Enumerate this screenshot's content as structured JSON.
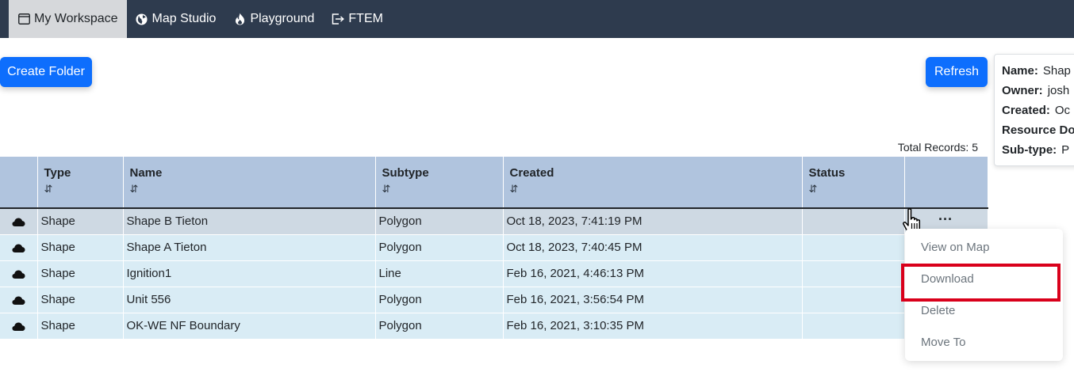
{
  "nav": {
    "items": [
      {
        "label": "My Workspace",
        "icon": "window-icon",
        "active": true
      },
      {
        "label": "Map Studio",
        "icon": "globe-icon"
      },
      {
        "label": "Playground",
        "icon": "fire-icon"
      },
      {
        "label": "FTEM",
        "icon": "box-arrow-right-icon"
      }
    ]
  },
  "toolbar": {
    "create_folder": "Create Folder",
    "refresh": "Refresh"
  },
  "total_records": "Total Records: 5",
  "info_panel": {
    "name_label": "Name:",
    "name_value": "Shap",
    "owner_label": "Owner:",
    "owner_value": "josh",
    "created_label": "Created:",
    "created_value": "Oc",
    "resource_label": "Resource Do",
    "subtype_label": "Sub-type:",
    "subtype_value": "P"
  },
  "table": {
    "headers": [
      "Type",
      "Name",
      "Subtype",
      "Created",
      "Status"
    ],
    "sort_glyph": "⇵",
    "rows": [
      {
        "type": "Shape",
        "name": "Shape B Tieton",
        "subtype": "Polygon",
        "created": "Oct 18, 2023, 7:41:19 PM",
        "status": ""
      },
      {
        "type": "Shape",
        "name": "Shape A Tieton",
        "subtype": "Polygon",
        "created": "Oct 18, 2023, 7:40:45 PM",
        "status": ""
      },
      {
        "type": "Shape",
        "name": "Ignition1",
        "subtype": "Line",
        "created": "Feb 16, 2021, 4:46:13 PM",
        "status": ""
      },
      {
        "type": "Shape",
        "name": "Unit 556",
        "subtype": "Polygon",
        "created": "Feb 16, 2021, 3:56:54 PM",
        "status": ""
      },
      {
        "type": "Shape",
        "name": "OK-WE NF Boundary",
        "subtype": "Polygon",
        "created": "Feb 16, 2021, 3:10:35 PM",
        "status": ""
      }
    ]
  },
  "row_actions_glyph": "···",
  "context_menu": {
    "items": [
      "View on Map",
      "Download",
      "Delete",
      "Move To"
    ]
  },
  "colors": {
    "navbar": "#2e3b4e",
    "primary": "#0d6efd",
    "header": "#b0c4de",
    "row": "#d9ecf5",
    "selected_row": "#ced9e3",
    "highlight": "#d9001b"
  }
}
